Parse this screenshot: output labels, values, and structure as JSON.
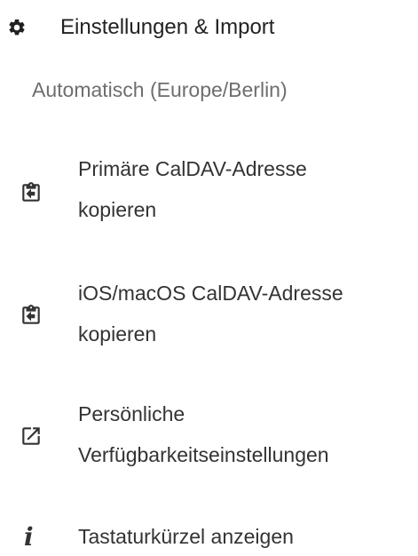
{
  "settings_section": {
    "header": {
      "icon": "gear-icon",
      "label": "Einstellungen & Import"
    },
    "timezone": "Automatisch (Europe/Berlin)",
    "items": [
      {
        "icon": "clipboard-arrow-icon",
        "label_line1": "Primäre CalDAV-Adresse",
        "label_line2": "kopieren"
      },
      {
        "icon": "clipboard-arrow-icon",
        "label_line1": "iOS/macOS CalDAV-Adresse",
        "label_line2": "kopieren"
      },
      {
        "icon": "open-in-new-icon",
        "label_line1": "Persönliche",
        "label_line2": "Verfügbarkeitseinstellungen"
      },
      {
        "icon": "info-icon",
        "label_line1": "Tastaturkürzel anzeigen"
      }
    ]
  },
  "colors": {
    "text_primary": "#222222",
    "text_secondary": "#6e6e6e",
    "icon": "#333333"
  }
}
